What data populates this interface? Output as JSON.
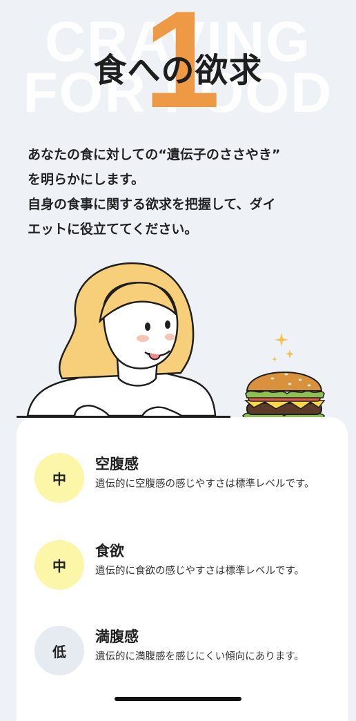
{
  "hero": {
    "bg_line1": "CRAVING",
    "bg_line2": "FOR FOOD",
    "number": "1",
    "title": "食への欲求"
  },
  "intro": {
    "line1": "あなたの食に対しての“遺伝子のささやき”",
    "line2": "を明らかにします。",
    "line3": "自身の食事に関する欲求を把握して、ダイ",
    "line4": "エットに役立ててください。"
  },
  "traits": [
    {
      "level": "中",
      "name": "空腹感",
      "desc": "遺伝的に空腹感の感じやすさは標準レベルです。",
      "badge_color": "#fbf6a8"
    },
    {
      "level": "中",
      "name": "食欲",
      "desc": "遺伝的に食欲の感じやすさは標準レベルです。",
      "badge_color": "#fbf6a8"
    },
    {
      "level": "低",
      "name": "満腹感",
      "desc": "遺伝的に満腹感を感じにくい傾向にあります。",
      "badge_color": "#e6ebf2"
    }
  ],
  "colors": {
    "accent_orange": "#ee9a45",
    "background": "#eef2f7",
    "hair": "#f7cf7a"
  }
}
